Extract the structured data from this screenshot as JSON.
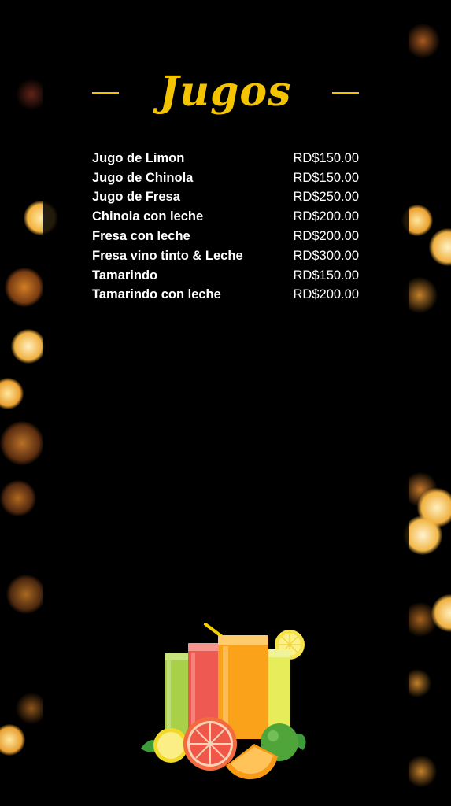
{
  "menu": {
    "title": "Jugos",
    "items": [
      {
        "name": "Jugo de Limon",
        "price": "RD$150.00"
      },
      {
        "name": "Jugo de Chinola",
        "price": "RD$150.00"
      },
      {
        "name": "Jugo de Fresa",
        "price": "RD$250.00"
      },
      {
        "name": "Chinola con leche",
        "price": "RD$200.00"
      },
      {
        "name": "Fresa con leche",
        "price": "RD$200.00"
      },
      {
        "name": "Fresa vino tinto & Leche",
        "price": "RD$300.00"
      },
      {
        "name": "Tamarindo",
        "price": "RD$150.00"
      },
      {
        "name": "Tamarindo con leche",
        "price": "RD$200.00"
      }
    ]
  },
  "colors": {
    "title": "#f5c400",
    "text": "#ffffff",
    "background": "#000000",
    "bokeh": "#e8a020"
  },
  "decoration": {
    "background": "bokeh-lights",
    "illustration": "juice-glasses-with-citrus-fruit"
  }
}
